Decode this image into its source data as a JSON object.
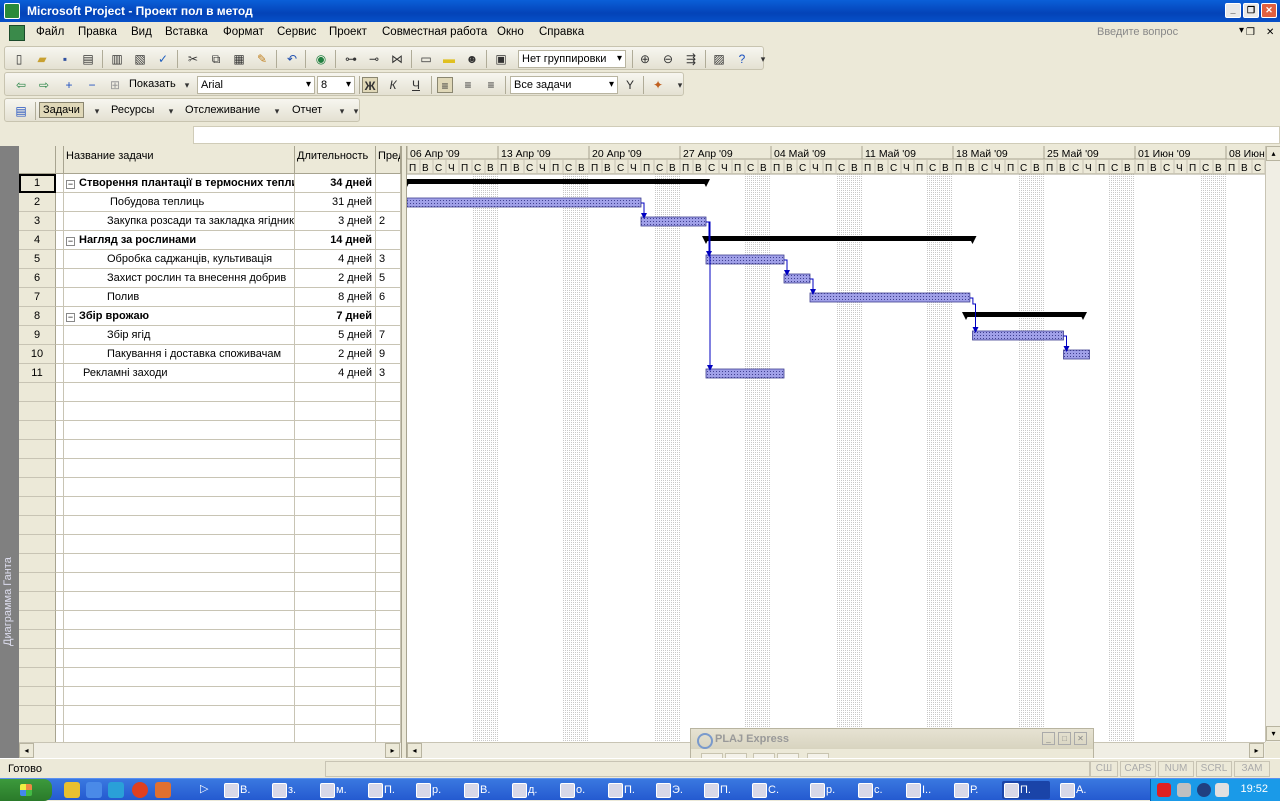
{
  "window": {
    "title": "Microsoft Project - Проект пол в метод"
  },
  "menu": {
    "items": [
      "Файл",
      "Правка",
      "Вид",
      "Вставка",
      "Формат",
      "Сервис",
      "Проект",
      "Совместная работа",
      "Окно",
      "Справка"
    ],
    "help_placeholder": "Введите вопрос"
  },
  "toolbar1": {
    "grouping": "Нет группировки"
  },
  "toolbar2": {
    "show_label": "Показать",
    "font": "Arial",
    "font_size": "8",
    "bold": "Ж",
    "italic": "К",
    "underline": "Ч",
    "filter": "Все задачи"
  },
  "toolbar3": {
    "tasks": "Задачи",
    "resources": "Ресурсы",
    "tracking": "Отслеживание",
    "report": "Отчет"
  },
  "view_label": "Диаграмма Ганта",
  "columns": {
    "name": "Название задачи",
    "duration": "Длительность",
    "predecessors": "Пред"
  },
  "tasks": [
    {
      "id": "1",
      "name": "Створення плантації  в термосних теплицях",
      "duration": "34 дней",
      "pred": "",
      "summary": true,
      "level": 0
    },
    {
      "id": "2",
      "name": "Побудова теплиць",
      "duration": "31 дней",
      "pred": "",
      "summary": false,
      "level": 1
    },
    {
      "id": "3",
      "name": "Закупка розсади та закладка ягідника",
      "duration": "3 дней",
      "pred": "2",
      "summary": false,
      "level": 1
    },
    {
      "id": "4",
      "name": "Нагляд за рослинами",
      "duration": "14 дней",
      "pred": "",
      "summary": true,
      "level": 0
    },
    {
      "id": "5",
      "name": "Обробка саджанців, культивація",
      "duration": "4 дней",
      "pred": "3",
      "summary": false,
      "level": 1
    },
    {
      "id": "6",
      "name": "Захист рослин та внесення добрив",
      "duration": "2 дней",
      "pred": "5",
      "summary": false,
      "level": 1
    },
    {
      "id": "7",
      "name": "Полив",
      "duration": "8 дней",
      "pred": "6",
      "summary": false,
      "level": 1
    },
    {
      "id": "8",
      "name": "Збір врожаю",
      "duration": "7 дней",
      "pred": "",
      "summary": true,
      "level": 0
    },
    {
      "id": "9",
      "name": "Збір ягід",
      "duration": "5 дней",
      "pred": "7",
      "summary": false,
      "level": 1
    },
    {
      "id": "10",
      "name": "Пакування  і доставка споживачам",
      "duration": "2 дней",
      "pred": "9",
      "summary": false,
      "level": 1
    },
    {
      "id": "11",
      "name": "Рекламні заходи",
      "duration": "4 дней",
      "pred": "3",
      "summary": false,
      "level": -1
    }
  ],
  "timescale": {
    "weeks": [
      "06 Апр '09",
      "13 Апр '09",
      "20 Апр '09",
      "27 Апр '09",
      "04 Май '09",
      "11 Май '09",
      "18 Май '09",
      "25 Май '09",
      "01 Июн '09",
      "08 Июн"
    ],
    "days": [
      "П",
      "В",
      "С",
      "Ч",
      "П",
      "С",
      "В"
    ]
  },
  "status": {
    "text": "Готово",
    "indicators": [
      "СШ",
      "CAPS",
      "NUM",
      "SCRL",
      "ЗАМ"
    ]
  },
  "plaj": {
    "title": "PLAJ Express"
  },
  "taskbar": {
    "items": [
      "В.",
      "з.",
      "м.",
      "П.",
      "р.",
      "В.",
      "д.",
      "о.",
      "П.",
      "Э.",
      "П.",
      "С.",
      "р.",
      "с.",
      "I..",
      "Р.",
      "П.",
      "А."
    ],
    "clock": "19:52"
  },
  "colors": {
    "title_blue": "#0a5fd8",
    "bar_fill": "#8c8cd8",
    "summary_bar": "#000000",
    "link": "#0000c0"
  }
}
